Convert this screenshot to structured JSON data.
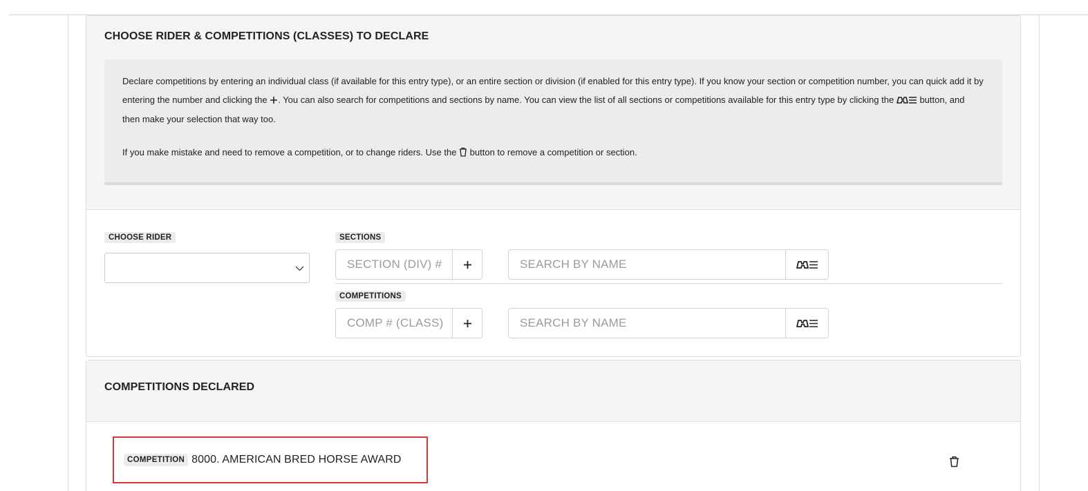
{
  "choose_panel": {
    "title": "CHOOSE RIDER & COMPETITIONS (CLASSES) TO DECLARE",
    "info": {
      "line1_part1": "Declare competitions by entering an individual class (if available for this entry type), or an entire section or division (if enabled for this entry type). If you know your section or competition number, you can quick add it by entering the number and clicking the",
      "line1_part2": ". You can also search for competitions and sections by name. You can view the list of all sections or competitions available for this entry type by clicking the",
      "line1_part3": "button, and then make your selection that way too.",
      "line2_part1": "If you make mistake and need to remove a competition, or to change riders. Use the",
      "line2_part2": "button to remove a competition or section."
    },
    "rider": {
      "label": "CHOOSE RIDER",
      "value": ""
    },
    "sections": {
      "label": "SECTIONS",
      "number_placeholder": "SECTION (DIV) #",
      "search_placeholder": "SEARCH BY NAME",
      "add_icon": "plus-icon",
      "list_icon": "binoculars-list-icon"
    },
    "competitions": {
      "label": "COMPETITIONS",
      "number_placeholder": "COMP # (CLASS)",
      "search_placeholder": "SEARCH BY NAME",
      "add_icon": "plus-icon",
      "list_icon": "binoculars-list-icon"
    }
  },
  "declared_panel": {
    "title": "COMPETITIONS DECLARED",
    "items": [
      {
        "tag": "COMPETITION",
        "name": "8000. AMERICAN BRED HORSE AWARD",
        "delete_icon": "trash-icon"
      }
    ]
  },
  "colors": {
    "highlight_border": "#d93535",
    "panel_bg": "#f5f5f5",
    "info_bg": "#ececec"
  }
}
